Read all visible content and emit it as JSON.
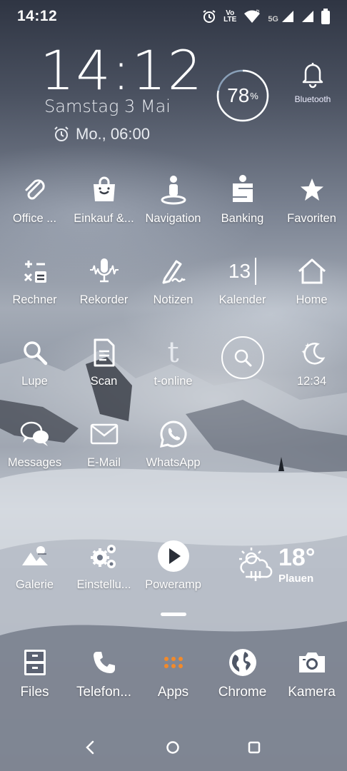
{
  "status_bar": {
    "time": "14:12",
    "icons": [
      "alarm-icon",
      "volte-icon",
      "wifi-icon",
      "signal-icon",
      "signal-icon",
      "battery-icon"
    ],
    "volte_top": "Vo",
    "volte_bottom": "LTE",
    "wifi_badge": "6",
    "network": "5G"
  },
  "clock_widget": {
    "time": "14:12",
    "date": "Samstag 3 Mai",
    "alarm": "Mo., 06:00"
  },
  "battery_widget": {
    "percent": 78,
    "text": "78",
    "unit": "%"
  },
  "bluetooth_widget": {
    "label": "Bluetooth",
    "icon": "bell-icon"
  },
  "rows": [
    [
      {
        "label": "Office ...",
        "icon": "paperclip-icon"
      },
      {
        "label": "Einkauf &...",
        "icon": "shopping-bag-icon"
      },
      {
        "label": "Navigation",
        "icon": "navigation-icon"
      },
      {
        "label": "Banking",
        "icon": "sparkasse-icon"
      },
      {
        "label": "Favoriten",
        "icon": "star-icon"
      }
    ],
    [
      {
        "label": "Rechner",
        "icon": "calculator-icon"
      },
      {
        "label": "Rekorder",
        "icon": "microphone-icon"
      },
      {
        "label": "Notizen",
        "icon": "pen-icon"
      },
      {
        "label": "Kalender",
        "icon": "calendar-icon",
        "day": "13"
      },
      {
        "label": "Home",
        "icon": "home-icon"
      }
    ],
    [
      {
        "label": "Lupe",
        "icon": "magnifier-icon"
      },
      {
        "label": "Scan",
        "icon": "document-icon"
      },
      {
        "label": "t-online",
        "icon": "t-online-icon",
        "glyph": "t"
      },
      {
        "label": "",
        "icon": "search-widget-icon"
      },
      {
        "label": "12:34",
        "icon": "moon-stars-icon"
      }
    ],
    [
      {
        "label": "Messages",
        "icon": "chat-bubbles-icon"
      },
      {
        "label": "E-Mail",
        "icon": "envelope-icon"
      },
      {
        "label": "WhatsApp",
        "icon": "whatsapp-icon"
      }
    ],
    [
      {
        "label": "Galerie",
        "icon": "gallery-icon"
      },
      {
        "label": "Einstellu...",
        "icon": "gears-icon"
      },
      {
        "label": "Poweramp",
        "icon": "play-icon"
      }
    ]
  ],
  "weather": {
    "temp": "18°",
    "city": "Plauen",
    "icon": "cloud-sun-rain-icon"
  },
  "dock": [
    {
      "label": "Files",
      "icon": "file-cabinet-icon"
    },
    {
      "label": "Telefon...",
      "icon": "phone-icon"
    },
    {
      "label": "Apps",
      "icon": "apps-grid-icon"
    },
    {
      "label": "Chrome",
      "icon": "globe-icon"
    },
    {
      "label": "Kamera",
      "icon": "camera-icon"
    }
  ],
  "colors": {
    "apps_dots": "#f28a2a",
    "battery_ring": "#ffffff",
    "battery_track": "#8aa0b8"
  }
}
